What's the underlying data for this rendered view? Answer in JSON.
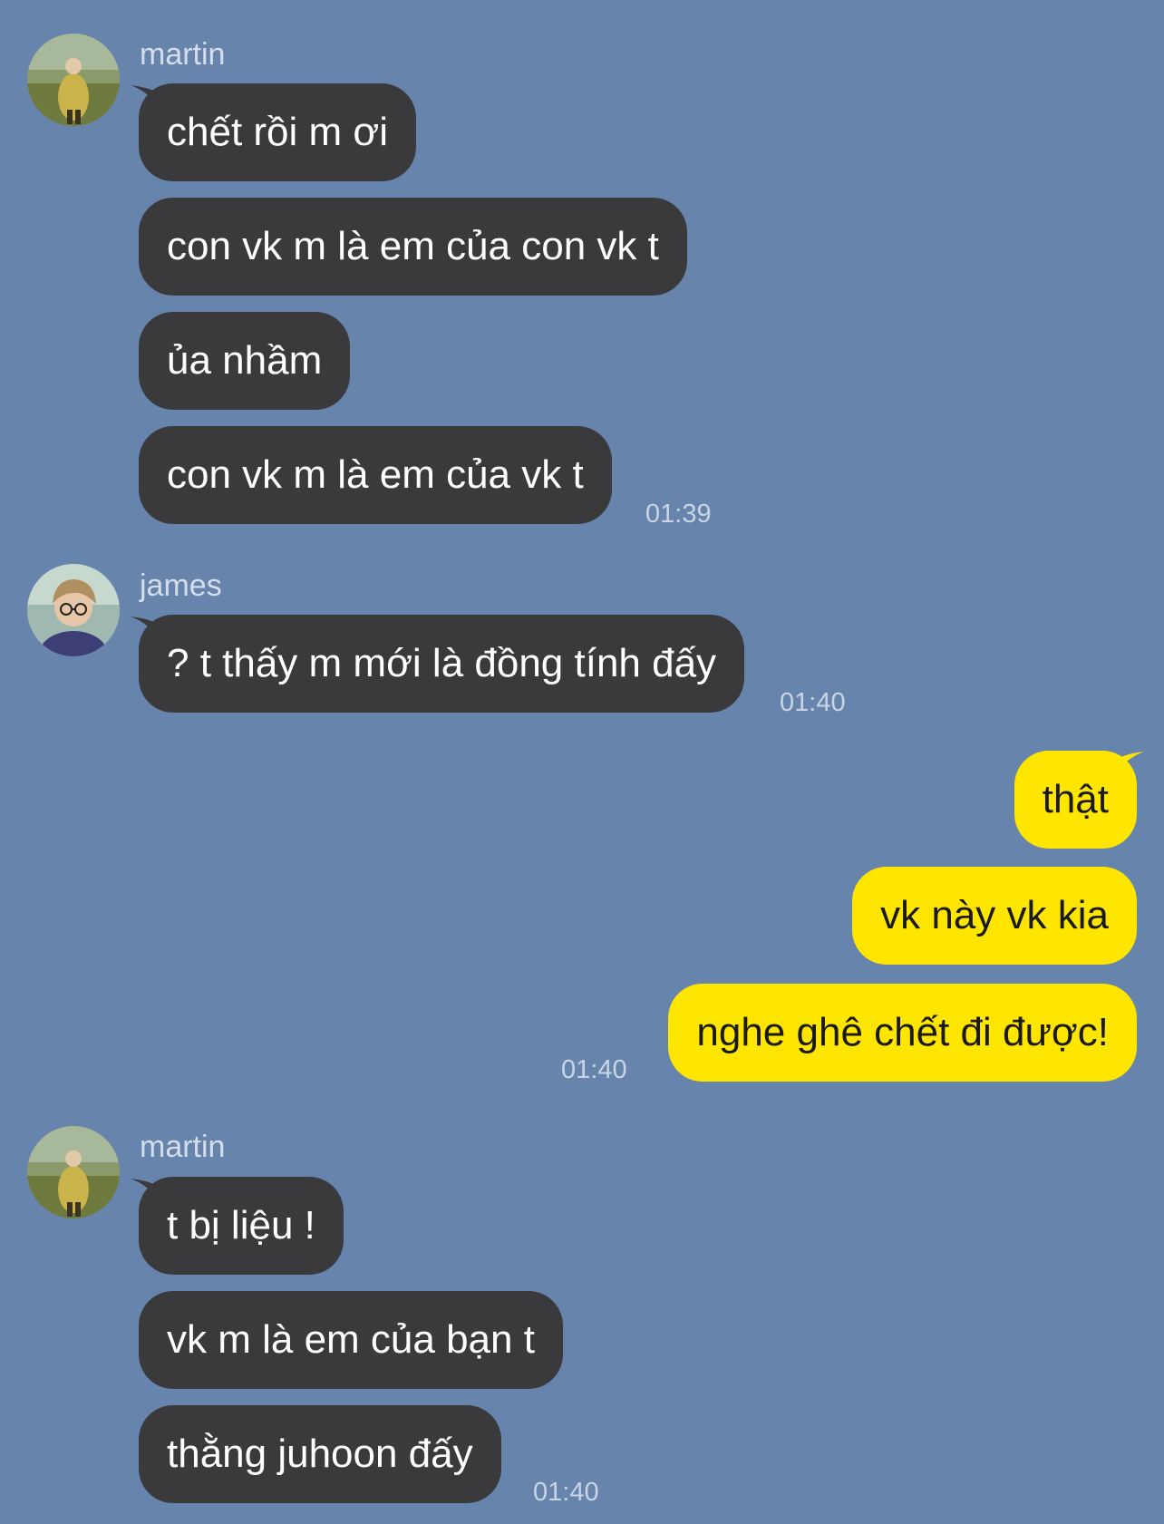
{
  "theme": {
    "background": "#6784ad",
    "incoming_bubble": "#3a3a3d",
    "outgoing_bubble": "#ffe600"
  },
  "groups": [
    {
      "sender": "martin",
      "avatar": "martin-avatar",
      "messages": [
        "chết rồi m ơi",
        "con vk m là em của con vk t",
        "ủa nhầm",
        "con vk m là em của vk t"
      ],
      "time": "01:39"
    },
    {
      "sender": "james",
      "avatar": "james-avatar",
      "messages": [
        "? t thấy m mới là đồng tính đấy"
      ],
      "time": "01:40"
    },
    {
      "outgoing": true,
      "messages": [
        "thật",
        "vk này vk kia",
        "nghe ghê chết đi được!"
      ],
      "time": "01:40"
    },
    {
      "sender": "martin",
      "avatar": "martin-avatar",
      "messages": [
        "t bị liệu !",
        "vk m là em của bạn t",
        "thằng juhoon đấy"
      ],
      "time": "01:40"
    }
  ]
}
